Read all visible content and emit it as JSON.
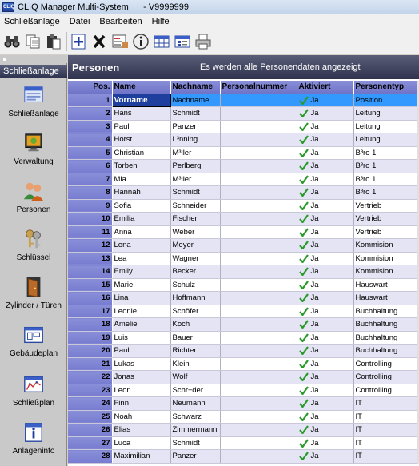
{
  "window": {
    "title": "CLIQ Manager Multi-System      - V9999999",
    "icon_text": "CLIQ"
  },
  "menu": [
    "Schließanlage",
    "Datei",
    "Bearbeiten",
    "Hilfe"
  ],
  "toolbar": {
    "buttons": [
      "binoculars-icon",
      "copy-icon",
      "paste-icon",
      "add-icon",
      "delete-icon",
      "edit-icon",
      "info-icon",
      "table-icon",
      "list-icon",
      "print-icon"
    ]
  },
  "sidebar": {
    "header": "Schließanlage",
    "items": [
      {
        "label": "Schließanlage",
        "icon": "lock-system-icon"
      },
      {
        "label": "Verwaltung",
        "icon": "admin-monitor-icon"
      },
      {
        "label": "Personen",
        "icon": "people-icon"
      },
      {
        "label": "Schlüssel",
        "icon": "keys-icon"
      },
      {
        "label": "Zylinder / Türen",
        "icon": "door-icon"
      },
      {
        "label": "Gebäudeplan",
        "icon": "building-plan-icon"
      },
      {
        "label": "Schließplan",
        "icon": "locking-plan-icon"
      },
      {
        "label": "Anlageninfo",
        "icon": "info-icon"
      }
    ]
  },
  "main": {
    "title": "Personen",
    "info": "Es werden alle Personendaten angezeigt",
    "columns": {
      "pos": "Pos.",
      "name": "Name",
      "nachname": "Nachname",
      "personalnummer": "Personalnummer",
      "aktiviert": "Aktiviert",
      "personentyp": "Personentyp"
    },
    "rows": [
      {
        "pos": "1",
        "name": "Vorname",
        "nachname": "Nachname",
        "personalnummer": "",
        "aktiviert": "Ja",
        "personentyp": "Position"
      },
      {
        "pos": "2",
        "name": "Hans",
        "nachname": "Schmidt",
        "personalnummer": "",
        "aktiviert": "Ja",
        "personentyp": "Leitung"
      },
      {
        "pos": "3",
        "name": "Paul",
        "nachname": "Panzer",
        "personalnummer": "",
        "aktiviert": "Ja",
        "personentyp": "Leitung"
      },
      {
        "pos": "4",
        "name": "Horst",
        "nachname": "L³nning",
        "personalnummer": "",
        "aktiviert": "Ja",
        "personentyp": "Leitung"
      },
      {
        "pos": "5",
        "name": "Christian",
        "nachname": "M³ller",
        "personalnummer": "",
        "aktiviert": "Ja",
        "personentyp": "B³ro 1"
      },
      {
        "pos": "6",
        "name": "Torben",
        "nachname": "Perlberg",
        "personalnummer": "",
        "aktiviert": "Ja",
        "personentyp": "B³ro 1"
      },
      {
        "pos": "7",
        "name": "Mia",
        "nachname": "M³ller",
        "personalnummer": "",
        "aktiviert": "Ja",
        "personentyp": "B³ro 1"
      },
      {
        "pos": "8",
        "name": "Hannah",
        "nachname": "Schmidt",
        "personalnummer": "",
        "aktiviert": "Ja",
        "personentyp": "B³ro 1"
      },
      {
        "pos": "9",
        "name": "Sofia",
        "nachname": "Schneider",
        "personalnummer": "",
        "aktiviert": "Ja",
        "personentyp": "Vertrieb"
      },
      {
        "pos": "10",
        "name": "Emilia",
        "nachname": "Fischer",
        "personalnummer": "",
        "aktiviert": "Ja",
        "personentyp": "Vertrieb"
      },
      {
        "pos": "11",
        "name": "Anna",
        "nachname": "Weber",
        "personalnummer": "",
        "aktiviert": "Ja",
        "personentyp": "Vertrieb"
      },
      {
        "pos": "12",
        "name": "Lena",
        "nachname": "Meyer",
        "personalnummer": "",
        "aktiviert": "Ja",
        "personentyp": "Kommision"
      },
      {
        "pos": "13",
        "name": "Lea",
        "nachname": "Wagner",
        "personalnummer": "",
        "aktiviert": "Ja",
        "personentyp": "Kommision"
      },
      {
        "pos": "14",
        "name": "Emily",
        "nachname": "Becker",
        "personalnummer": "",
        "aktiviert": "Ja",
        "personentyp": "Kommision"
      },
      {
        "pos": "15",
        "name": "Marie",
        "nachname": "Schulz",
        "personalnummer": "",
        "aktiviert": "Ja",
        "personentyp": "Hauswart"
      },
      {
        "pos": "16",
        "name": "Lina",
        "nachname": "Hoffmann",
        "personalnummer": "",
        "aktiviert": "Ja",
        "personentyp": "Hauswart"
      },
      {
        "pos": "17",
        "name": "Leonie",
        "nachname": "Schõfer",
        "personalnummer": "",
        "aktiviert": "Ja",
        "personentyp": "Buchhaltung"
      },
      {
        "pos": "18",
        "name": "Amelie",
        "nachname": "Koch",
        "personalnummer": "",
        "aktiviert": "Ja",
        "personentyp": "Buchhaltung"
      },
      {
        "pos": "19",
        "name": "Luis",
        "nachname": "Bauer",
        "personalnummer": "",
        "aktiviert": "Ja",
        "personentyp": "Buchhaltung"
      },
      {
        "pos": "20",
        "name": "Paul",
        "nachname": "Richter",
        "personalnummer": "",
        "aktiviert": "Ja",
        "personentyp": "Buchhaltung"
      },
      {
        "pos": "21",
        "name": "Lukas",
        "nachname": "Klein",
        "personalnummer": "",
        "aktiviert": "Ja",
        "personentyp": "Controlling"
      },
      {
        "pos": "22",
        "name": "Jonas",
        "nachname": "Wolf",
        "personalnummer": "",
        "aktiviert": "Ja",
        "personentyp": "Controlling"
      },
      {
        "pos": "23",
        "name": "Leon",
        "nachname": "Schr÷der",
        "personalnummer": "",
        "aktiviert": "Ja",
        "personentyp": "Controlling"
      },
      {
        "pos": "24",
        "name": "Finn",
        "nachname": "Neumann",
        "personalnummer": "",
        "aktiviert": "Ja",
        "personentyp": "IT"
      },
      {
        "pos": "25",
        "name": "Noah",
        "nachname": "Schwarz",
        "personalnummer": "",
        "aktiviert": "Ja",
        "personentyp": "IT"
      },
      {
        "pos": "26",
        "name": "Elias",
        "nachname": "Zimmermann",
        "personalnummer": "",
        "aktiviert": "Ja",
        "personentyp": "IT"
      },
      {
        "pos": "27",
        "name": "Luca",
        "nachname": "Schmidt",
        "personalnummer": "",
        "aktiviert": "Ja",
        "personentyp": "IT"
      },
      {
        "pos": "28",
        "name": "Maximilian",
        "nachname": "Panzer",
        "personalnummer": "",
        "aktiviert": "Ja",
        "personentyp": "IT"
      }
    ]
  },
  "colors": {
    "header_bar": "#30334d",
    "grid_header": "#7b80d0",
    "row_alt": "#e4e4f4",
    "selection": "#1f3f9f",
    "highlight": "#3399ff",
    "check": "#2a9a2a"
  }
}
